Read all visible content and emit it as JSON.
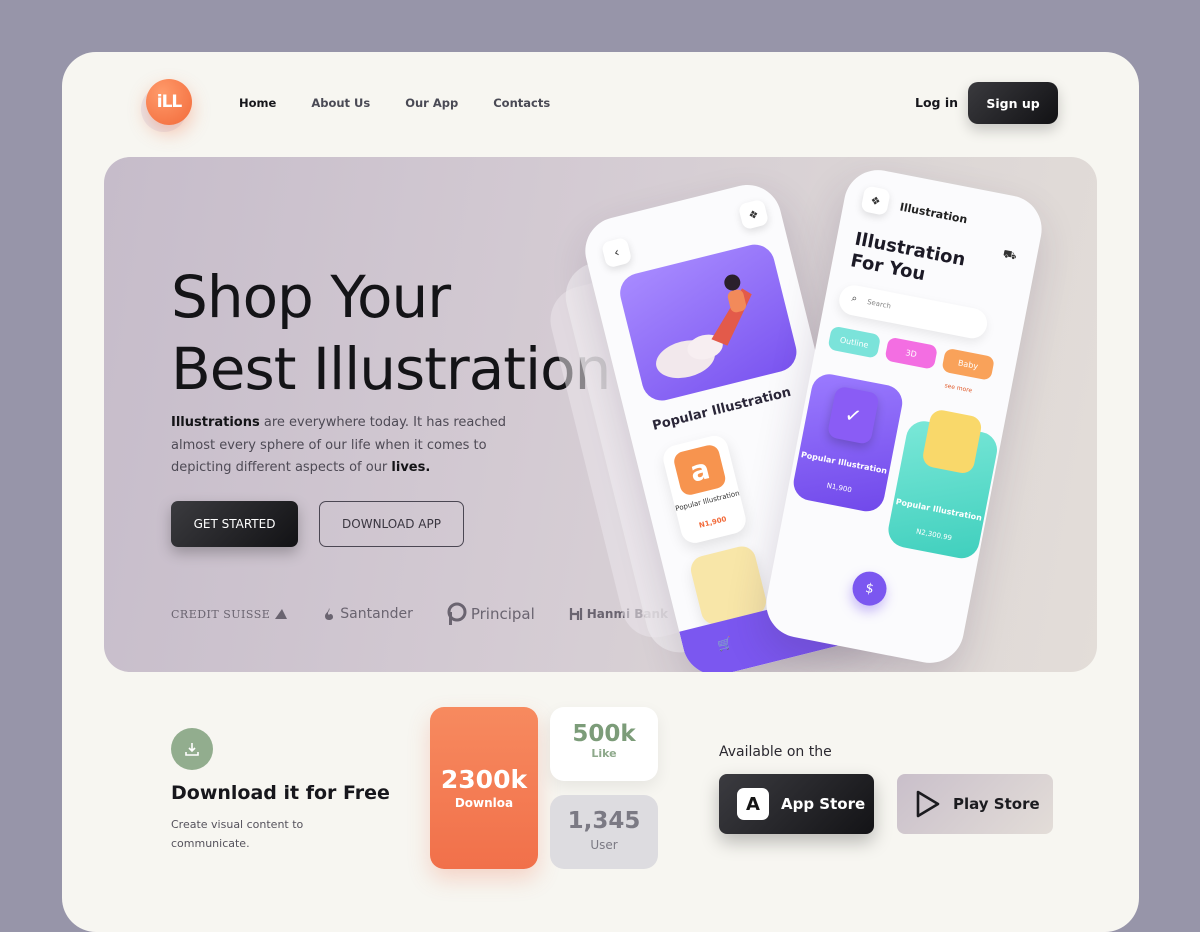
{
  "brand": {
    "logo_text": "iLL"
  },
  "nav": {
    "items": [
      {
        "label": "Home"
      },
      {
        "label": "About Us"
      },
      {
        "label": "Our App"
      },
      {
        "label": "Contacts"
      }
    ]
  },
  "auth": {
    "login_label": "Log in",
    "signup_label": "Sign up"
  },
  "hero": {
    "title_line1": "Shop Your",
    "title_line2": "Best Illustration",
    "desc_bold1": "Illustrations",
    "desc_mid": " are everywhere today. It has reached almost every sphere of our life when it comes to depicting different aspects of our ",
    "desc_bold2": "lives.",
    "cta_primary": "GET STARTED",
    "cta_secondary": "DOWNLOAD APP",
    "partners": [
      "CREDIT SUISSE",
      "Santander",
      "Principal",
      "Hanmi Bank"
    ]
  },
  "phone_left": {
    "section_title": "Popular Illustration",
    "card": {
      "title": "Popular Illustration",
      "price": "N1,900"
    }
  },
  "phone_right": {
    "header": "Illustration",
    "headline_line1": "Illustration",
    "headline_line2": "For You",
    "search_placeholder": "Search",
    "chips": [
      "Outline",
      "3D",
      "Baby"
    ],
    "see_more": "see more",
    "cards": [
      {
        "title": "Popular Illustration",
        "price": "N1,900"
      },
      {
        "title": "Popular Illustration",
        "price": "N2,300.99"
      }
    ]
  },
  "download": {
    "title": "Download it for Free",
    "subtitle": "Create visual content to communicate."
  },
  "stats": {
    "downloads": {
      "value": "2300k",
      "label": "Downloa"
    },
    "likes": {
      "value": "500k",
      "label": "Like"
    },
    "users": {
      "value": "1,345",
      "label": "User"
    }
  },
  "stores": {
    "available_label": "Available on the",
    "app_store": "App Store",
    "play_store": "Play Store"
  },
  "colors": {
    "accent_orange": "#f26a3a",
    "accent_purple": "#7b57f0",
    "accent_green": "#92ad8e",
    "background": "#9795a9"
  }
}
